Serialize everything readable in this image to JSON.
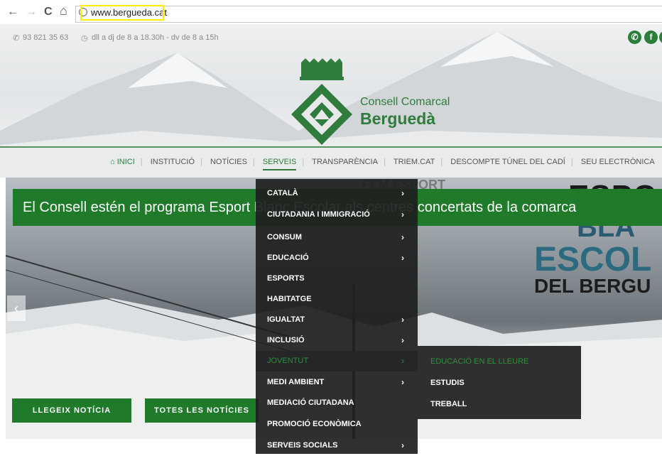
{
  "browser": {
    "back": "←",
    "forward": "→",
    "reload": "C",
    "home": "⌂",
    "url": "www.bergueda.cat"
  },
  "topbar": {
    "phone": "93 821 35 63",
    "hours": "dll a dj de 8 a 18.30h - dv de 8 a 15h",
    "social": [
      "✆",
      "f"
    ]
  },
  "logo": {
    "line1": "Consell Comarcal",
    "line2": "Berguedà"
  },
  "menu": {
    "items": [
      "INICI",
      "INSTITUCIÓ",
      "NOTÍCIES",
      "SERVEIS",
      "TRANSPARÈNCIA",
      "TRIEM.CAT",
      "DESCOMPTE TÚNEL DEL CADÍ",
      "SEU ELECTRÒNICA"
    ],
    "active": "SERVEIS"
  },
  "slider": {
    "headline": "El Consell estén el programa Esport Blanc Escolar als centres concertats de la comarca",
    "poster_top": "ESPO",
    "poster_line1": "BLA",
    "poster_line2": "ESCOL",
    "poster_line3": "DEL BERGU",
    "poster_faint": "FEM ESPORT",
    "prev_arrow": "‹",
    "button_read": "LLEGEIX NOTÍCIA",
    "button_all": "TOTES LES NOTÍCIES"
  },
  "dropdown": {
    "items": [
      {
        "label": "CATALÀ",
        "chevron": "›"
      },
      {
        "label": "CIUTADANIA I IMMIGRACIÓ",
        "chevron": "›"
      },
      {
        "label": "CONSUM",
        "chevron": "›"
      },
      {
        "label": "EDUCACIÓ",
        "chevron": "›"
      },
      {
        "label": "ESPORTS",
        "chevron": ""
      },
      {
        "label": "HABITATGE",
        "chevron": ""
      },
      {
        "label": "IGUALTAT",
        "chevron": "›"
      },
      {
        "label": "INCLUSIÓ",
        "chevron": "›"
      },
      {
        "label": "JOVENTUT",
        "chevron": "›"
      },
      {
        "label": "MEDI AMBIENT",
        "chevron": "›"
      },
      {
        "label": "MEDIACIÓ CIUTADANA",
        "chevron": ""
      },
      {
        "label": "PROMOCIÓ ECONÒMICA",
        "chevron": ""
      },
      {
        "label": "SERVEIS SOCIALS",
        "chevron": "›"
      }
    ],
    "active": "JOVENTUT",
    "submenu": [
      "EDUCACIÓ EN EL LLEURE",
      "ESTUDIS",
      "TREBALL"
    ],
    "submenu_active": "EDUCACIÓ EN EL LLEURE"
  },
  "colors": {
    "brand_green": "#1f7a2a",
    "url_highlight": "#ffee00"
  }
}
